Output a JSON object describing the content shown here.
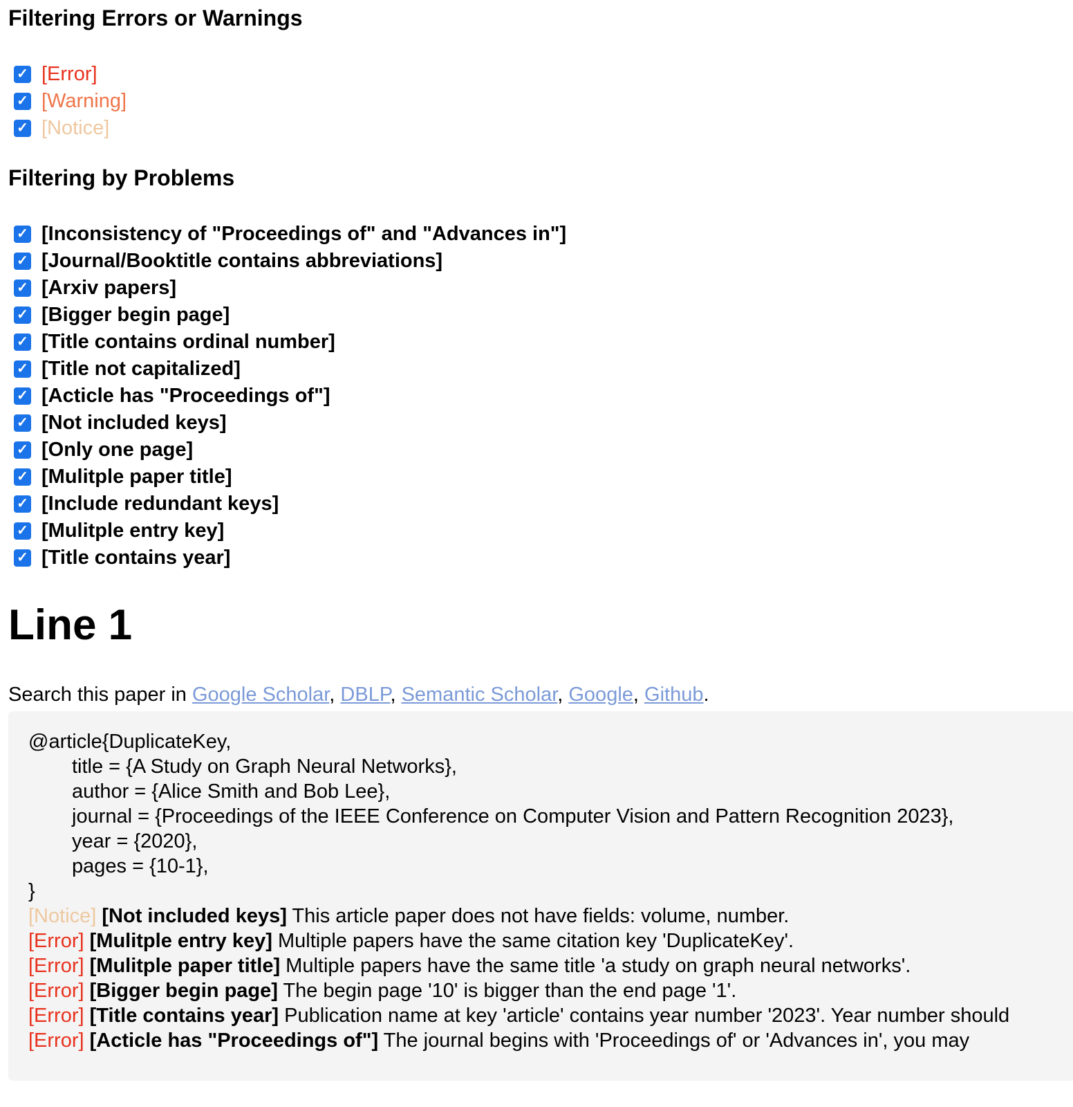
{
  "levels": {
    "title": "Filtering Errors or Warnings",
    "items": [
      "[Error]",
      "[Warning]",
      "[Notice]"
    ],
    "colors": {
      "error": "#e8321e",
      "warning": "#f0744a",
      "notice": "#eec8a0"
    },
    "checkbox_color": "#1a73e8"
  },
  "problems": {
    "title": "Filtering by Problems",
    "items": [
      "[Inconsistency of \"Proceedings of\" and \"Advances in\"]",
      "[Journal/Booktitle contains abbreviations]",
      "[Arxiv papers]",
      "[Bigger begin page]",
      "[Title contains ordinal number]",
      "[Title not capitalized]",
      "[Acticle has \"Proceedings of\"]",
      "[Not included keys]",
      "[Only one page]",
      "[Mulitple paper title]",
      "[Include redundant keys]",
      "[Mulitple entry key]",
      "[Title contains year]"
    ]
  },
  "line": {
    "heading": "Line 1",
    "search_prefix": "Search this paper in ",
    "links": [
      "Google Scholar",
      "DBLP",
      "Semantic Scholar",
      "Google",
      "Github"
    ],
    "sep": ", ",
    "end": ".",
    "bibtex": {
      "open": "@article{DuplicateKey,",
      "fields": [
        "title = {A Study on Graph Neural Networks},",
        "author = {Alice Smith and Bob Lee},",
        "journal = {Proceedings of the IEEE Conference on Computer Vision and Pattern Recognition 2023},",
        "year = {2020},",
        "pages = {10-1},"
      ],
      "close": "}"
    },
    "messages": [
      {
        "level": "[Notice]",
        "cls": "note",
        "problem": "[Not included keys]",
        "text": " This article paper does not have fields: volume, number."
      },
      {
        "level": "[Error]",
        "cls": "err",
        "problem": "[Mulitple entry key]",
        "text": " Multiple papers have the same citation key 'DuplicateKey'."
      },
      {
        "level": "[Error]",
        "cls": "err",
        "problem": "[Mulitple paper title]",
        "text": " Multiple papers have the same title 'a study on graph neural networks'."
      },
      {
        "level": "[Error]",
        "cls": "err",
        "problem": "[Bigger begin page]",
        "text": " The begin page '10' is bigger than the end page '1'."
      },
      {
        "level": "[Error]",
        "cls": "err",
        "problem": "[Title contains year]",
        "text": " Publication name at key 'article' contains year number '2023'. Year number should"
      },
      {
        "level": "[Error]",
        "cls": "err",
        "problem": "[Acticle has \"Proceedings of\"]",
        "text": " The journal begins with 'Proceedings of' or 'Advances in', you may"
      }
    ]
  }
}
